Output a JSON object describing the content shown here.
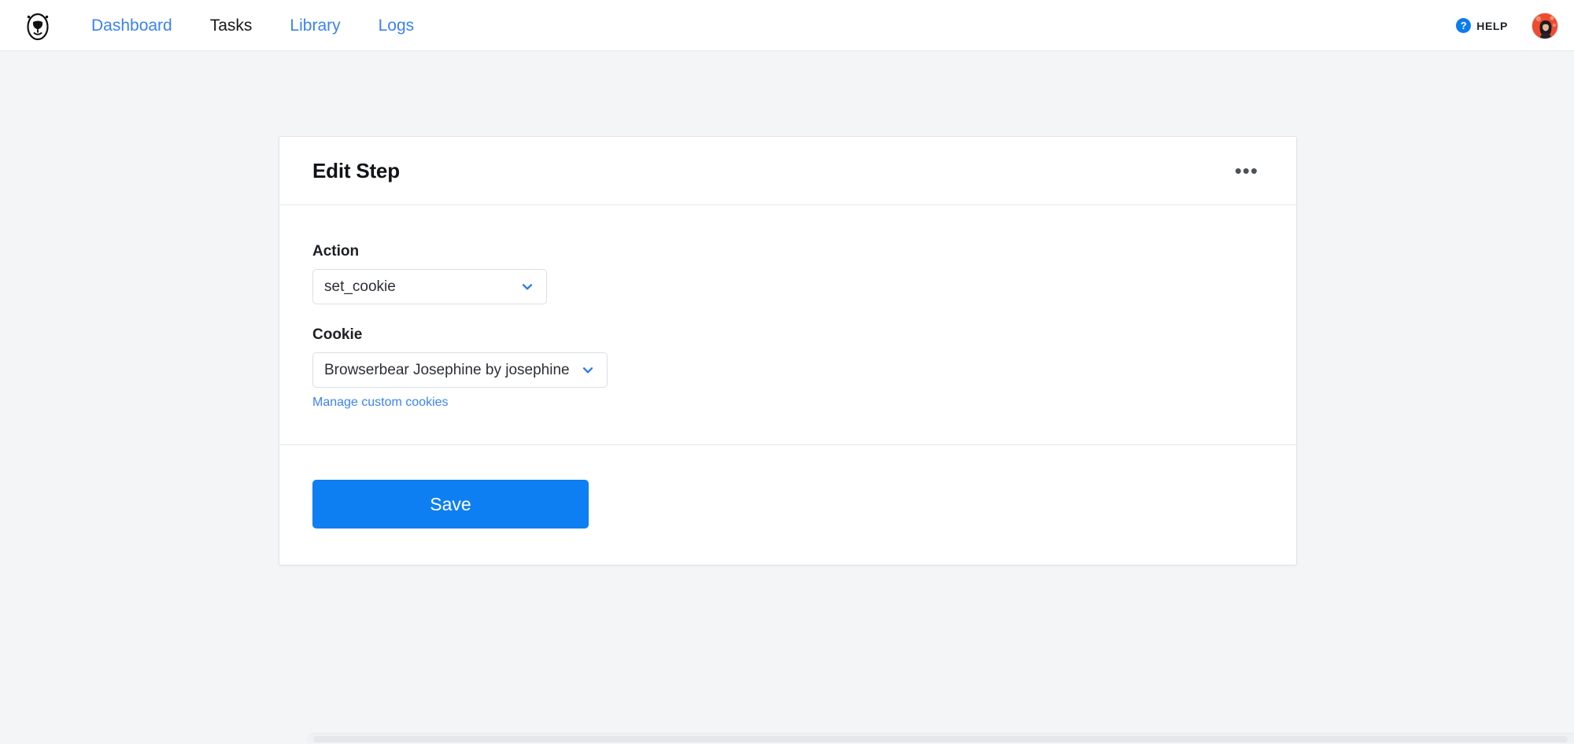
{
  "navbar": {
    "logo_name": "browserbear-logo",
    "links": [
      {
        "label": "Dashboard",
        "active": false
      },
      {
        "label": "Tasks",
        "active": true
      },
      {
        "label": "Library",
        "active": false
      },
      {
        "label": "Logs",
        "active": false
      }
    ],
    "help": {
      "icon": "question-mark-circle-icon",
      "label": "HELP"
    },
    "avatar": {
      "name": "user-avatar",
      "background_color": "#e8563c"
    }
  },
  "card": {
    "title": "Edit Step",
    "overflow_menu_label": "•••",
    "fields": {
      "action": {
        "label": "Action",
        "value": "set_cookie",
        "chevron_icon": "chevron-down-icon"
      },
      "cookie": {
        "label": "Cookie",
        "value": "Browserbear Josephine by josephine",
        "chevron_icon": "chevron-down-icon",
        "helper_link": "Manage custom cookies"
      }
    },
    "footer": {
      "save_label": "Save"
    }
  },
  "colors": {
    "accent_blue": "#0d7ff2",
    "link_blue": "#3b82f6",
    "page_background": "#f4f5f7",
    "card_background": "#ffffff",
    "border": "#e3e4e8",
    "text_primary": "#111318"
  }
}
